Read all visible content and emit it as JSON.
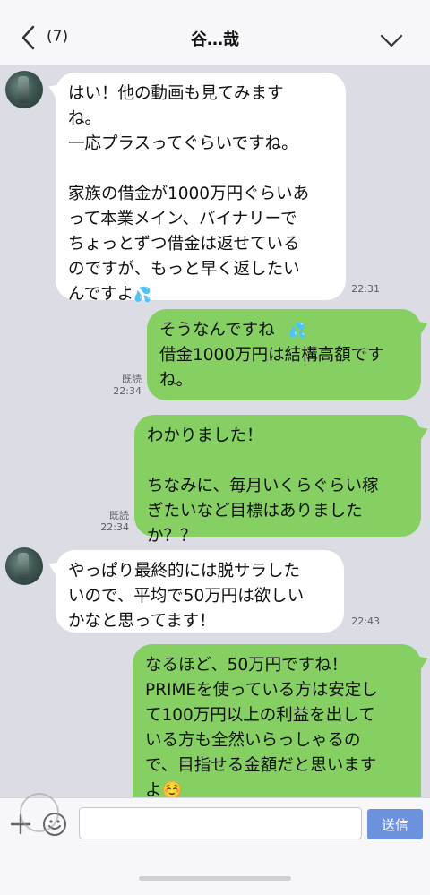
{
  "header": {
    "unread_count": "(7)",
    "title": "谷…哉"
  },
  "messages": [
    {
      "side": "in",
      "text": "はい！他の動画も見てみます\nね。\n一応プラスってぐらいですね。\n\n家族の借金が1000万円ぐらいあ\nって本業メイン、バイナリーで\nちょっとずつ借金は返せている\nのですが、もっと早く返したい\nんですよ",
      "time": "22:31"
    },
    {
      "side": "out",
      "text": "そうなんですね\n借金1000万円は結構高額です\nね。",
      "read": "既読",
      "time": "22:34"
    },
    {
      "side": "out",
      "text": "わかりました！\n\nちなみに、毎月いくらぐらい稼\nぎたいなど目標はありました\nか？？",
      "read": "既読",
      "time": "22:34"
    },
    {
      "side": "in",
      "text": "やっぱり最終的には脱サラした\nいので、平均で50万円は欲しい\nかなと思ってます！",
      "time": "22:43"
    },
    {
      "side": "out",
      "text": "なるほど、50万円ですね！\nPRIMEを使っている方は安定し\nて100万円以上の利益を出して\nいる方も全然いらっしゃるの\nで、目指せる金額だと思います\nよ☺️",
      "read": "",
      "time": ""
    }
  ],
  "input": {
    "placeholder": "",
    "send_label": "送信"
  },
  "colors": {
    "outgoing_bubble": "#86d063",
    "incoming_bubble": "#ffffff",
    "chat_background": "#dcdde4",
    "send_button": "#6c92dd"
  }
}
